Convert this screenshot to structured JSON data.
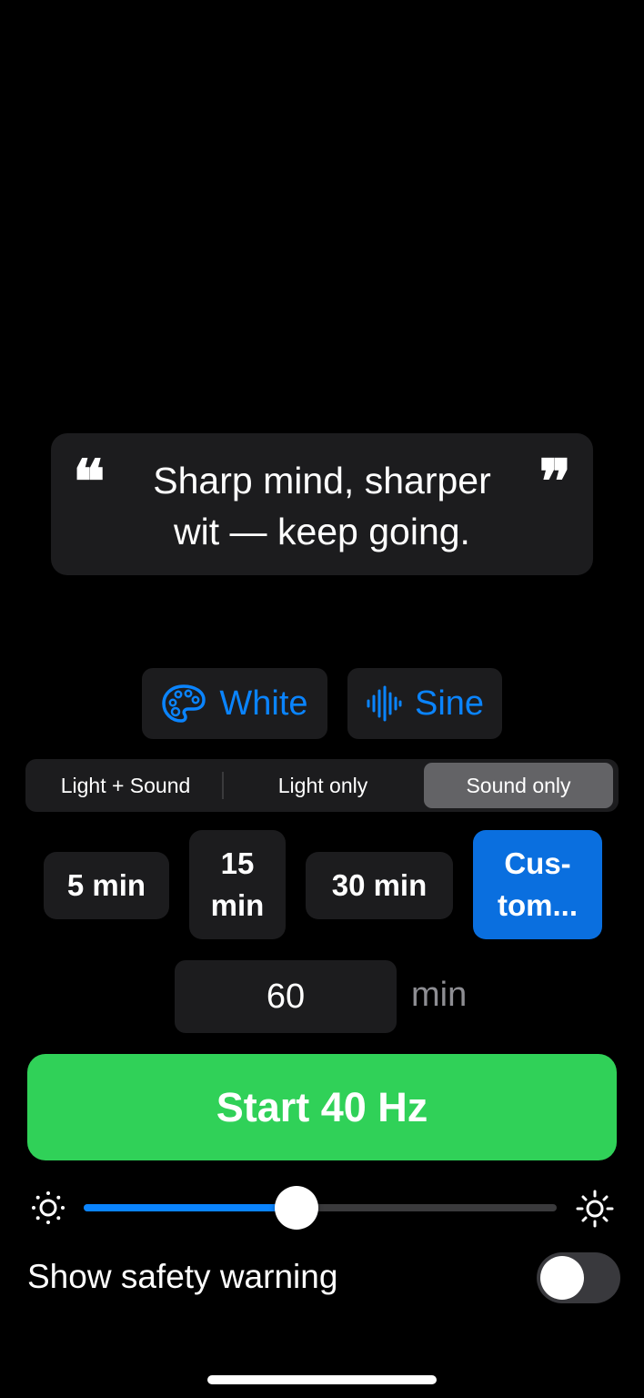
{
  "quote": {
    "text": "Sharp mind, sharper wit — keep going.",
    "open_mark": "❝",
    "close_mark": "❞"
  },
  "sound": {
    "color_chip": {
      "label": "White",
      "icon": "palette-icon"
    },
    "waveform_chip": {
      "label": "Sine",
      "icon": "waveform-icon"
    }
  },
  "mode": {
    "options": [
      "Light + Sound",
      "Light only",
      "Sound only"
    ],
    "selected": "Sound only"
  },
  "durations": {
    "options": [
      "5 min",
      "15\nmin",
      "30 min",
      "Cus-\ntom..."
    ],
    "selected": "Cus-\ntom..."
  },
  "custom_minutes": {
    "value": "60",
    "unit": "min"
  },
  "start_button": {
    "label": "Start 40 Hz"
  },
  "brightness": {
    "level": 0.45,
    "left_icon": "sun-dim-icon",
    "right_icon": "sun-bright-icon"
  },
  "safety": {
    "label": "Show safety warning",
    "enabled": false
  },
  "colors": {
    "accent": "#0a84ff",
    "start": "#30d158",
    "selected_duration": "#0a6fdf",
    "card": "#1c1c1e"
  }
}
